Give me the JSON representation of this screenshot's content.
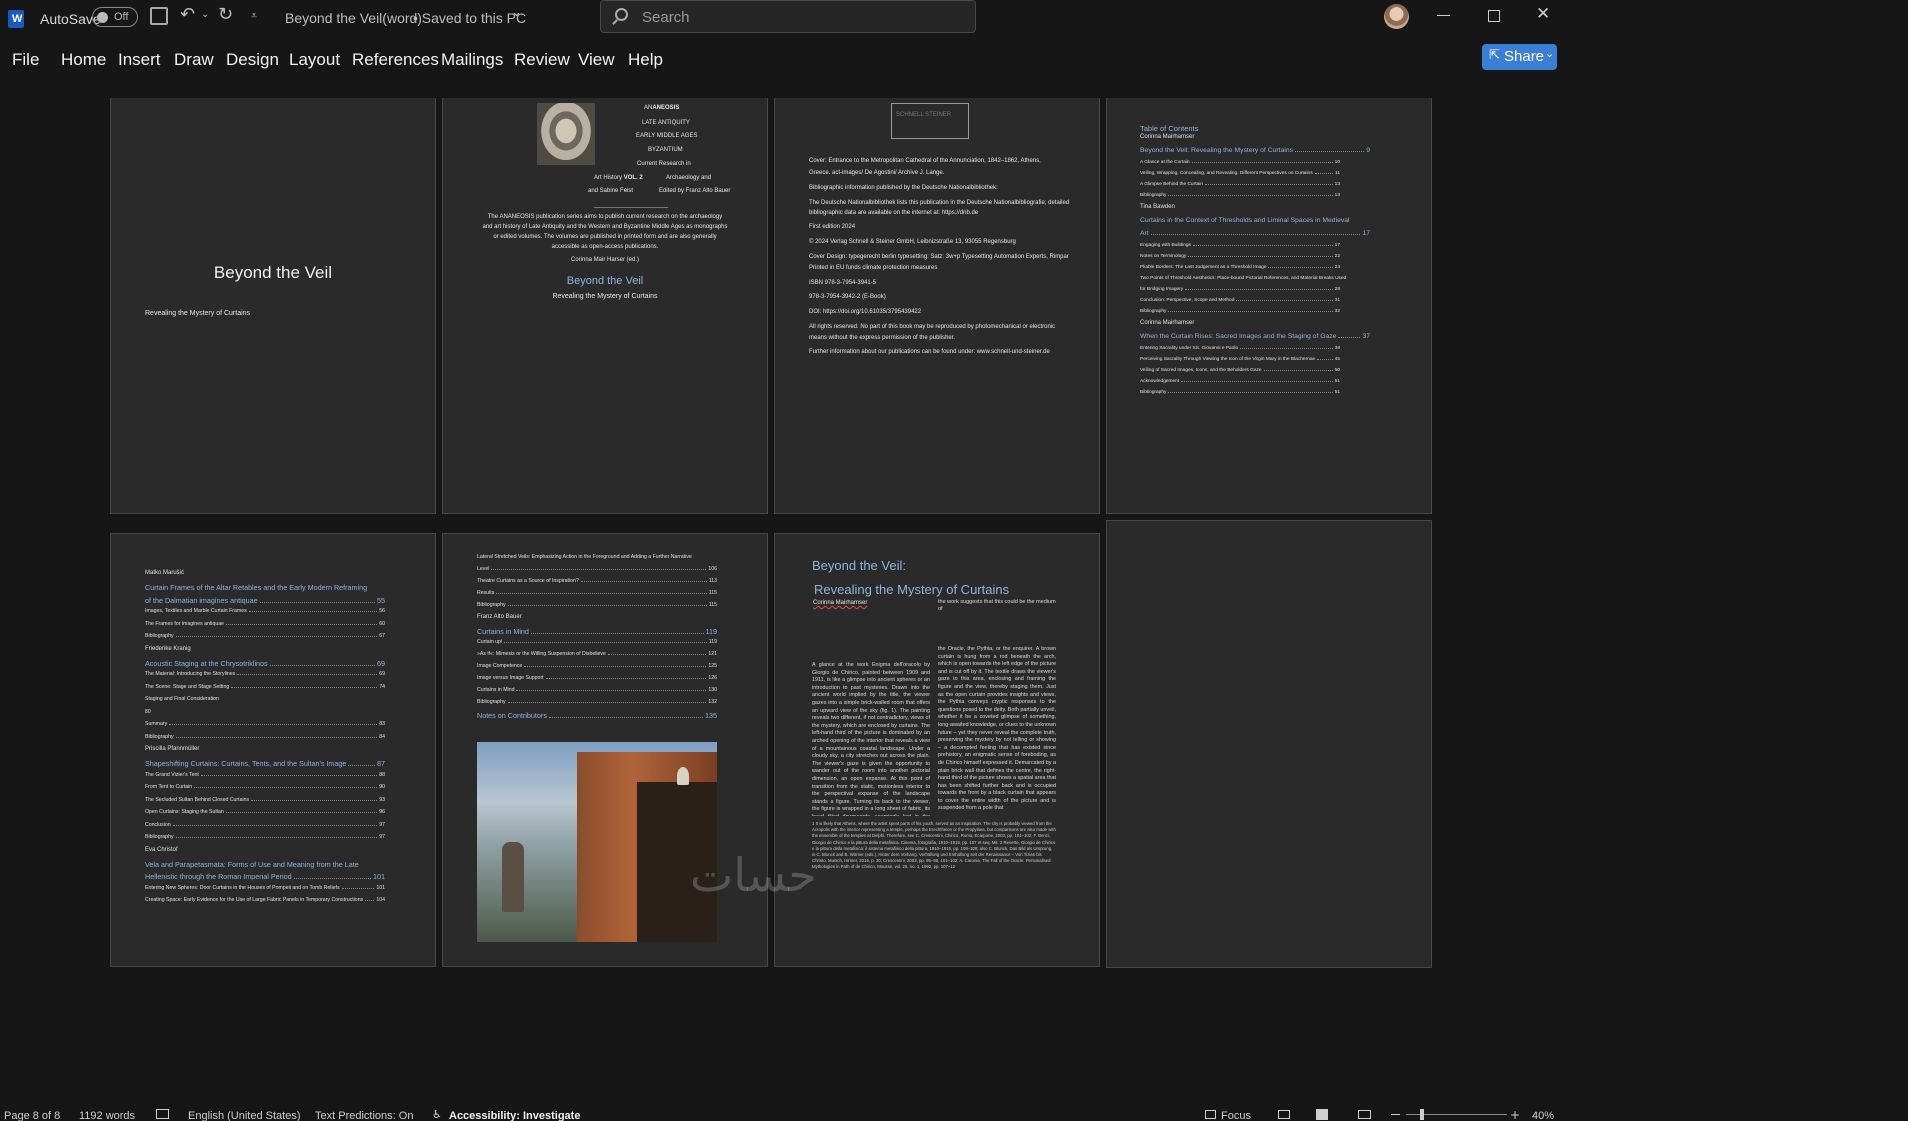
{
  "titlebar": {
    "app_icon": "word-icon",
    "autosave_label": "AutoSave",
    "autosave_state": "Off",
    "doc_title": "Beyond the Veil(word)",
    "save_status": "• Saved to this PC",
    "search_placeholder": "Search"
  },
  "ribbon": {
    "tabs": [
      "File",
      "Home",
      "Insert",
      "Draw",
      "Design",
      "Layout",
      "References",
      "Mailings",
      "Review",
      "View",
      "Help"
    ],
    "share_label": "Share"
  },
  "pages": {
    "p1": {
      "title": "Beyond the Veil",
      "subtitle": "Revealing the Mystery of Curtains"
    },
    "p2": {
      "series_a": "AN",
      "series_b": "ANEOSIS",
      "series_lines": [
        "LATE ANTIQUITY",
        "EARLY MIDDLE AGES",
        "BYZANTIUM",
        "Current Research in"
      ],
      "art_history": "Art History",
      "vol": "VOL. 2",
      "archaeology": "Archaeology and",
      "and_sabine": "and Sabine Feist",
      "edited_by": "Edited by Franz Alto Bauer",
      "blurb": [
        "The ANANEOSIS publication series aims to publish current research on the archaeology",
        "and art history of Late Antiquity and the Western and Byzantine Middle Ages as monographs",
        "or edited volumes. The volumes are published in printed form and are also generally",
        "accessible as open-access publications."
      ],
      "editor": "Corinna Mair Harser (ed.)",
      "title": "Beyond the Veil",
      "subtitle": "Revealing the Mystery of Curtains"
    },
    "p3": {
      "logo": "SCHNELL STEINER",
      "lines": [
        "Cover: Entrance to the Metropolitan Cathedral of the Annunciation, 1842–1862, Athens,",
        "Greece. act-images/ De Agostini/ Archive J. Lange.",
        "Bibliographic information published by the Deutsche Nationalbibliothek:",
        "The Deutsche Nationalbibliothek lists this publication in the Deutsche Nationalbibliografie; detailed",
        "bibliographic data are available on the internet at: https://dnb.de",
        "First edition 2024",
        "© 2024 Verlag Schnell & Steiner GmbH, Leibnizstraße 13, 93055 Regensburg",
        "Cover Design: typegerecht berlin typesetting: Satz: 3w+p Typesetting Automation Experts, Rimpar",
        "Printed in EU funds climate protection measures",
        "ISBN 978-3-7954-3941-5",
        "978-3-7954-3942-2 (E-Book)",
        "DOI: https://doi.org/10.61035/3795439422",
        "All rights reserved. No part of this book may be reproduced by photomechanical or electronic",
        "means without the express permission of the publisher.",
        "Further information about our publications can be found under: www.schnell-und-steiner.de"
      ]
    },
    "p4": {
      "heading": "Table of Contents",
      "entries": [
        {
          "t": "Corinna Mairhamser",
          "kind": "author"
        },
        {
          "t": "Beyond the Veil: Revealing the Mystery of Curtains",
          "p": "9",
          "kind": "chapter"
        },
        {
          "t": "A Glance at the Curtain",
          "p": "10",
          "kind": "sub"
        },
        {
          "t": "Veiling, Wrapping, Concealing, and Revealing. Different Perspectives on Curtains",
          "p": "11",
          "kind": "sub"
        },
        {
          "t": "A Glimpse Behind the Curtain",
          "p": "13",
          "kind": "sub"
        },
        {
          "t": "Bibliography",
          "p": "13",
          "kind": "sub"
        },
        {
          "t": "Tina Bawden",
          "kind": "author"
        },
        {
          "t": "Curtains in the Context of Thresholds and Liminal Spaces in Medieval",
          "kind": "chapter"
        },
        {
          "t": "Art",
          "p": "17",
          "kind": "chapter"
        },
        {
          "t": "Engaging with Buildings",
          "p": "17",
          "kind": "sub"
        },
        {
          "t": "Notes on Terminology",
          "p": "22",
          "kind": "sub"
        },
        {
          "t": "Pliable Borders: The Last Judgement as a Threshold Image",
          "p": "24",
          "kind": "sub"
        },
        {
          "t": "Two Points of Threshold Aesthetics: Place-bound Pictorial References, and Material Breaks Used",
          "kind": "sub"
        },
        {
          "t": "for Bridging Imagery",
          "p": "28",
          "kind": "sub"
        },
        {
          "t": "Conclusion: Perspective, Scope and Method",
          "p": "31",
          "kind": "sub"
        },
        {
          "t": "Bibliography",
          "p": "32",
          "kind": "sub"
        },
        {
          "t": "Corinna Mairhamser",
          "kind": "author"
        },
        {
          "t": "When the Curtain Rises: Sacred Images and the Staging of Gaze",
          "p": "37",
          "kind": "chapter"
        },
        {
          "t": "Entering Sacrality under SS. Giovanni e Paolo",
          "p": "38",
          "kind": "sub"
        },
        {
          "t": "Perceiving Sacrality Through Viewing the Icon of the Virgin Mary in the Blachernae",
          "p": "45",
          "kind": "sub"
        },
        {
          "t": "Veiling of Sacred Images, Icons, and the Beholders Gaze",
          "p": "50",
          "kind": "sub"
        },
        {
          "t": "Acknowledgement",
          "p": "51",
          "kind": "sub"
        },
        {
          "t": "Bibliography",
          "p": "51",
          "kind": "sub"
        }
      ]
    },
    "p5": {
      "entries": [
        {
          "t": "Matko Marušić",
          "kind": "author"
        },
        {
          "t": "Curtain Frames of the Altar Retables and the Early Modern Reframing",
          "kind": "chapter"
        },
        {
          "t": "of the Dalmatian imagines antiquae",
          "p": "55",
          "kind": "chapter"
        },
        {
          "t": "Images, Textiles and Marble Curtain Frames",
          "p": "56",
          "kind": "sub"
        },
        {
          "t": "The Frames for imagines antiquae",
          "p": "60",
          "kind": "sub"
        },
        {
          "t": "Bibliography",
          "p": "67",
          "kind": "sub"
        },
        {
          "t": "Friederike Kranig",
          "kind": "author"
        },
        {
          "t": "Acoustic Staging at the Chrysotriklinos",
          "p": "69",
          "kind": "chapter"
        },
        {
          "t": "The Material: Introducing the Storylines",
          "p": "69",
          "kind": "sub"
        },
        {
          "t": "The Scene: Stage and Stage Setting",
          "p": "74",
          "kind": "sub"
        },
        {
          "t": "Staging and Final Consideration",
          "kind": "sub"
        },
        {
          "t": "80",
          "kind": "num"
        },
        {
          "t": "Summary",
          "p": "83",
          "kind": "sub"
        },
        {
          "t": "Bibliography",
          "p": "84",
          "kind": "sub"
        },
        {
          "t": "Priscilla Pfannmüller",
          "kind": "author"
        },
        {
          "t": "Shapeshifting Curtains: Curtains, Tents, and the Sultan's Image",
          "p": "87",
          "kind": "chapter"
        },
        {
          "t": "The Grand Vizier's Tent",
          "p": "88",
          "kind": "sub"
        },
        {
          "t": "From Tent to Curtain",
          "p": "90",
          "kind": "sub"
        },
        {
          "t": "The Secluded Sultan Behind Closed Curtains",
          "p": "93",
          "kind": "sub"
        },
        {
          "t": "Open Curtains: Staging the Sultan",
          "p": "96",
          "kind": "sub"
        },
        {
          "t": "Conclusion",
          "p": "97",
          "kind": "sub"
        },
        {
          "t": "Bibliography",
          "p": "97",
          "kind": "sub"
        },
        {
          "t": "Eva Christof",
          "kind": "author"
        },
        {
          "t": "Vela and Parapetasmata: Forms of Use and Meaning from the Late",
          "kind": "chapter"
        },
        {
          "t": "Hellenistic through the Roman Imperial Period",
          "p": "101",
          "kind": "chapter"
        },
        {
          "t": "Entering New Spheres: Door Curtains in the Houses of Pompeii and on Tomb Reliefs",
          "p": "101",
          "kind": "sub"
        },
        {
          "t": "Creating Space: Early Evidence for the Use of Large Fabric Panels in Temporary Constructions",
          "p": "104",
          "kind": "sub"
        }
      ]
    },
    "p6": {
      "entries": [
        {
          "t": "Lateral Stretched Veils: Emphasizing Action in the Foreground and Adding a Further Narrative",
          "kind": "sub"
        },
        {
          "t": "Level",
          "p": "106",
          "kind": "sub"
        },
        {
          "t": "Theatre Curtains as a Source of Inspiration?",
          "p": "113",
          "kind": "sub"
        },
        {
          "t": "Results",
          "p": "115",
          "kind": "sub"
        },
        {
          "t": "Bibliography",
          "p": "115",
          "kind": "sub"
        },
        {
          "t": "Franz Alto Bauer",
          "kind": "author"
        },
        {
          "t": "Curtains in Mind",
          "p": "119",
          "kind": "chapter"
        },
        {
          "t": "Curtain up!",
          "p": "119",
          "kind": "sub"
        },
        {
          "t": "»As if«: Mimesis or the Willing Suspension of Disbelieve",
          "p": "121",
          "kind": "sub"
        },
        {
          "t": "Image Competence",
          "p": "125",
          "kind": "sub"
        },
        {
          "t": "Image versus Image Support",
          "p": "126",
          "kind": "sub"
        },
        {
          "t": "Curtains in Mind",
          "p": "130",
          "kind": "sub"
        },
        {
          "t": "Bibliography",
          "p": "132",
          "kind": "sub"
        },
        {
          "t": "Notes on Contributors",
          "p": "135",
          "kind": "chapter"
        }
      ]
    },
    "p7": {
      "title1": "Beyond the Veil:",
      "title2": "Revealing the Mystery of Curtains",
      "author": "Corinna Mairhamser",
      "right_intro": "the work suggests that this could be the medium of",
      "left_col": "A glance at the work Enigma dell'oracolo by Giorgio de Chirico, painted between 1909 and 1911, is like a glimpse into ancient spheres or an introduction to past mysteries. Drawn into the ancient world implied by the title, the viewer gazes into a simple brick-walled room that offers an upward view of the sky (fig. 1). The painting reveals two different, if not contradictory, views of the mystery, which are enclosed by curtains. The left-hand third of the picture is dominated by an arched opening of the interior that reveals a view of a mountainous coastal landscape. Under a cloudy sky, a city stretches out across the plain. The viewer's gaze is given the opportunity to wander out of the room into another pictorial dimension, an open expanse. At this point of transition from the static, motionless interior to the perspectival expanse of the landscape stands a figure. Turning its back to the viewer, the figure is wrapped in a long sheet of fabric, its head tilted downwards, seemingly lost in the view. The title of",
      "right_col": "the Oracle, the Pythia, or the enquirer. A brown curtain is hung from a rod beneath the arch, which is open towards the left edge of the picture and is cut off by it. The textile draws the viewer's gaze to this area, enclosing and framing the figure and the view, thereby staging them. Just as the open curtain provides insights and views, the Pythia conveys cryptic responses to the questions posed to the deity. Both partially unveil, whether it be a coveted glimpse of something, long-awaited knowledge, or clues to the unknown future – yet they never reveal the complete truth, preserving the mystery by not telling or showing – a decompted feeling that has existed since prehistory, an enigmatic sense of foreboding, as de Chirico himself expressed it. Demarcated by a plain brick wall that defines the centre, the right-hand third of the picture shows a spatial area that has been shifted further back and is occupied towards the front by a black curtain that appears to cover the entire width of the picture and is suspended from a pole that",
      "footnotes": "1 It is likely that Athens, where the artist spent parts of his youth, served as an inspiration. The city is probably viewed from the Acropolis with the interior representing a temple, perhaps the Erechtheion or the Propylaea, but comparisons are also made with the ensemble of the temples at Delphi. Therefore, see C. Crescentini, Chirico, Roma, Ecarpone, 2003, pp. 101–102; F. Benzi, Giorgio de Chirico e la pittura della metafisica. Cinema, fotografia, 1910–1915, pp. 107 et seq. Mit. 2 Reverte, Giorgio de Chirico e la pittura della metafisica: il sistema metafisico della pittura, 1910–1915, pp. 108–109; also C. Blunck, Das Bild als Ursprung, in C. Blunck and B. Wörner (eds.), Hinter dem Vorhang. Verhüllung und Enthüllung seit der Renaissance – Von Tizian bis Christo, Munich, Hirmer, 2016, p. 30; Crescentini, 2003, pp. 95–98, 101–102; A. Caronia, The Fall of the Oracle: Personalised Mythologies in Path of de Chirico, Mousse, vol. 25, no. 1, 1992, pp. 107–12"
    }
  },
  "statusbar": {
    "page": "Page 8 of 8",
    "words": "1192 words",
    "language": "English (United States)",
    "text_predictions": "Text Predictions: On",
    "accessibility": "Accessibility: Investigate",
    "focus": "Focus",
    "zoom": "40%"
  },
  "watermark": "حسات"
}
